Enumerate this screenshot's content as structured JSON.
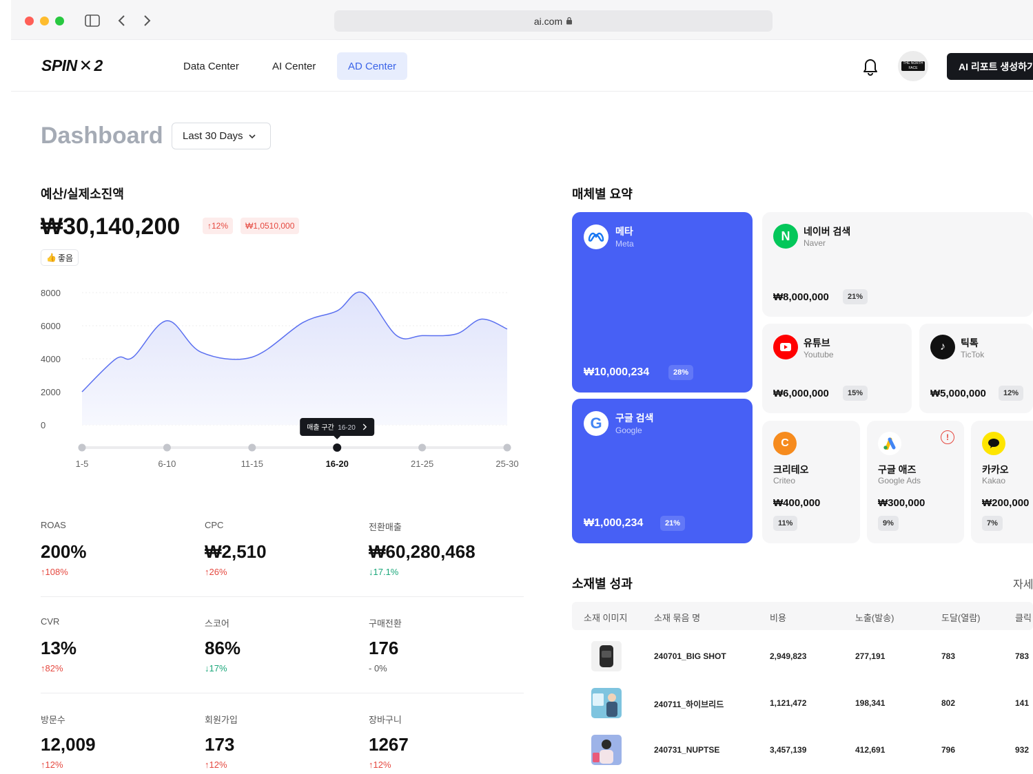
{
  "browser": {
    "url": "ai.com",
    "lock_icon": "lock-icon"
  },
  "nav": {
    "logo": "SPIN X 2",
    "items": [
      "Data Center",
      "AI Center",
      "AD Center"
    ],
    "active": "AD Center",
    "ai_button": "AI 리포트 생성하기",
    "brand_avatar": "THE NORTH FACE"
  },
  "dashboard": {
    "title": "Dashboard",
    "range": "Last 30 Days"
  },
  "budget": {
    "section_title": "예산/실제소진액",
    "total": "₩30,140,200",
    "change": "↑12%",
    "budget_chip": "₩1,0510,000",
    "rating": "좋음"
  },
  "colors": {
    "accent": "#4760f5",
    "up": "#e5483f",
    "down": "#1aa77a"
  },
  "chart_data": {
    "type": "area",
    "categories": [
      "1-5",
      "6-10",
      "11-15",
      "16-20",
      "21-25",
      "25-30"
    ],
    "x": [
      0,
      0.4,
      0.6,
      1,
      1.4,
      2,
      2.6,
      3,
      3.3,
      3.7,
      4,
      4.4,
      4.7,
      5
    ],
    "values": [
      2000,
      4000,
      4100,
      6300,
      4400,
      4100,
      6200,
      6900,
      8000,
      5400,
      5400,
      5500,
      6400,
      5800
    ],
    "ylim": [
      0,
      8000
    ],
    "yticks": [
      0,
      2000,
      4000,
      6000,
      8000
    ],
    "selected_category": "16-20",
    "tooltip_label": "매출 구간",
    "tooltip_value": "16-20",
    "grid": true
  },
  "metrics": [
    {
      "label": "ROAS",
      "value": "200%",
      "change": "↑108%",
      "dir": "up"
    },
    {
      "label": "CPC",
      "value": "₩2,510",
      "change": "↑26%",
      "dir": "up"
    },
    {
      "label": "전환매출",
      "value": "₩60,280,468",
      "change": "↓17.1%",
      "dir": "down"
    },
    {
      "label": "CVR",
      "value": "13%",
      "change": "↑82%",
      "dir": "up"
    },
    {
      "label": "스코어",
      "value": "86%",
      "change": "↓17%",
      "dir": "down"
    },
    {
      "label": "구매전환",
      "value": "176",
      "change": "- 0%",
      "dir": "flat"
    },
    {
      "label": "방문수",
      "value": "12,009",
      "change": "↑12%",
      "dir": "up"
    },
    {
      "label": "회원가입",
      "value": "173",
      "change": "↑12%",
      "dir": "up"
    },
    {
      "label": "장바구니",
      "value": "1267",
      "change": "↑12%",
      "dir": "up"
    }
  ],
  "media": {
    "section_title": "매체별 요약",
    "cards": [
      {
        "name": "메타",
        "sub": "Meta",
        "amount": "₩10,000,234",
        "pct": "28%"
      },
      {
        "name": "구글 검색",
        "sub": "Google",
        "amount": "₩1,000,234",
        "pct": "21%"
      },
      {
        "name": "네이버 검색",
        "sub": "Naver",
        "amount": "₩8,000,000",
        "pct": "21%"
      },
      {
        "name": "유튜브",
        "sub": "Youtube",
        "amount": "₩6,000,000",
        "pct": "15%"
      },
      {
        "name": "틱톡",
        "sub": "TicTok",
        "amount": "₩5,000,000",
        "pct": "12%"
      },
      {
        "name": "크리테오",
        "sub": "Criteo",
        "amount": "₩400,000",
        "pct": "11%"
      },
      {
        "name": "구글 애즈",
        "sub": "Google Ads",
        "amount": "₩300,000",
        "pct": "9%"
      },
      {
        "name": "카카오",
        "sub": "Kakao",
        "amount": "₩200,000",
        "pct": "7%"
      }
    ]
  },
  "creatives": {
    "section_title": "소재별 성과",
    "detail_link": "자세히",
    "columns": [
      "소재 이미지",
      "소재 묶음 명",
      "비용",
      "노출(발송)",
      "도달(열람)",
      "클릭"
    ],
    "rows": [
      {
        "name": "240701_BIG SHOT",
        "cost": "2,949,823",
        "impressions": "277,191",
        "reach": "783",
        "clicks": "783"
      },
      {
        "name": "240711_하이브리드",
        "cost": "1,121,472",
        "impressions": "198,341",
        "reach": "802",
        "clicks": "141"
      },
      {
        "name": "240731_NUPTSE",
        "cost": "3,457,139",
        "impressions": "412,691",
        "reach": "796",
        "clicks": "932"
      }
    ]
  }
}
